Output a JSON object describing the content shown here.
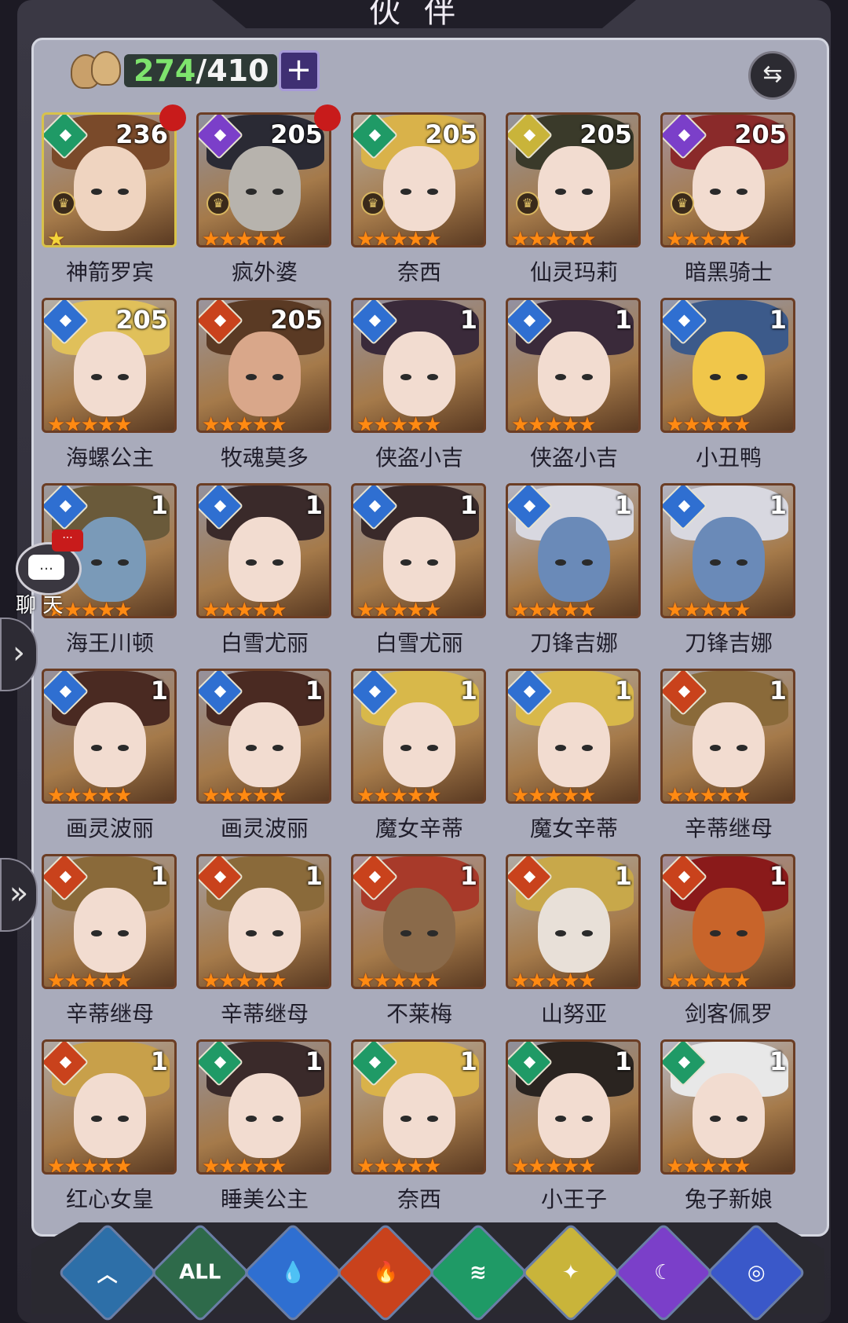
{
  "header": {
    "title": "伙伴"
  },
  "roster": {
    "current": "274",
    "separator": "/",
    "max": "410",
    "add_label": "+",
    "swap_label": "⇆"
  },
  "colors": {
    "water": "#2f6fd1",
    "fire": "#c9421c",
    "wind": "#1f9a66",
    "light": "#c9b43a",
    "dark": "#7b3fc9",
    "leader": "#c81b1b"
  },
  "cards": [
    {
      "name": "神箭罗宾",
      "level": "236",
      "element": "wind",
      "stars": "★",
      "star_color": "yellow",
      "gold": true,
      "crown": true,
      "badge": true,
      "skin": "#efd4c0",
      "hair": "#7a4a2a"
    },
    {
      "name": "疯外婆",
      "level": "205",
      "element": "dark",
      "stars": "★★★★★",
      "crown": true,
      "badge": true,
      "skin": "#b7b3ad",
      "hair": "#2a2a34"
    },
    {
      "name": "奈西",
      "level": "205",
      "element": "wind",
      "stars": "★★★★★",
      "crown": true,
      "skin": "#f2dcd0",
      "hair": "#d9b24a"
    },
    {
      "name": "仙灵玛莉",
      "level": "205",
      "element": "light",
      "stars": "★★★★★",
      "crown": true,
      "skin": "#f2dcd0",
      "hair": "#3a3a2a"
    },
    {
      "name": "暗黑骑士",
      "level": "205",
      "element": "dark",
      "stars": "★★★★★",
      "crown": true,
      "skin": "#f2dcd0",
      "hair": "#8a2a2a"
    },
    {
      "name": "海螺公主",
      "level": "205",
      "element": "water",
      "stars": "★★★★★",
      "skin": "#f2dcd0",
      "hair": "#e0c05a"
    },
    {
      "name": "牧魂莫多",
      "level": "205",
      "element": "fire",
      "stars": "★★★★★",
      "skin": "#d9a78a",
      "hair": "#5a3a24"
    },
    {
      "name": "侠盗小吉",
      "level": "1",
      "element": "water",
      "stars": "★★★★★",
      "skin": "#f2dcd0",
      "hair": "#3a2a3a"
    },
    {
      "name": "侠盗小吉",
      "level": "1",
      "element": "water",
      "stars": "★★★★★",
      "skin": "#f2dcd0",
      "hair": "#3a2a3a"
    },
    {
      "name": "小丑鸭",
      "level": "1",
      "element": "water",
      "stars": "★★★★★",
      "skin": "#f0c64a",
      "hair": "#3c5a8a"
    },
    {
      "name": "海王川顿",
      "level": "1",
      "element": "water",
      "stars": "★★★★★",
      "skin": "#7a9ab8",
      "hair": "#6a5a3a"
    },
    {
      "name": "白雪尤丽",
      "level": "1",
      "element": "water",
      "stars": "★★★★★",
      "skin": "#f2dcd0",
      "hair": "#3a2a2a"
    },
    {
      "name": "白雪尤丽",
      "level": "1",
      "element": "water",
      "stars": "★★★★★",
      "skin": "#f2dcd0",
      "hair": "#3a2a2a"
    },
    {
      "name": "刀锋吉娜",
      "level": "1",
      "element": "water",
      "stars": "★★★★★",
      "skin": "#6a8ab8",
      "hair": "#d8d8e0"
    },
    {
      "name": "刀锋吉娜",
      "level": "1",
      "element": "water",
      "stars": "★★★★★",
      "skin": "#6a8ab8",
      "hair": "#d8d8e0"
    },
    {
      "name": "画灵波丽",
      "level": "1",
      "element": "water",
      "stars": "★★★★★",
      "skin": "#f2dcd0",
      "hair": "#4a2a22"
    },
    {
      "name": "画灵波丽",
      "level": "1",
      "element": "water",
      "stars": "★★★★★",
      "skin": "#f2dcd0",
      "hair": "#4a2a22"
    },
    {
      "name": "魔女辛蒂",
      "level": "1",
      "element": "water",
      "stars": "★★★★★",
      "skin": "#f2dcd0",
      "hair": "#d8b84a"
    },
    {
      "name": "魔女辛蒂",
      "level": "1",
      "element": "water",
      "stars": "★★★★★",
      "skin": "#f2dcd0",
      "hair": "#d8b84a"
    },
    {
      "name": "辛蒂继母",
      "level": "1",
      "element": "fire",
      "stars": "★★★★★",
      "skin": "#f2dcd0",
      "hair": "#8a6a3a"
    },
    {
      "name": "辛蒂继母",
      "level": "1",
      "element": "fire",
      "stars": "★★★★★",
      "skin": "#f2dcd0",
      "hair": "#8a6a3a"
    },
    {
      "name": "辛蒂继母",
      "level": "1",
      "element": "fire",
      "stars": "★★★★★",
      "skin": "#f2dcd0",
      "hair": "#8a6a3a"
    },
    {
      "name": "不莱梅",
      "level": "1",
      "element": "fire",
      "stars": "★★★★★",
      "skin": "#8a6a4a",
      "hair": "#a83a2a"
    },
    {
      "name": "山努亚",
      "level": "1",
      "element": "fire",
      "stars": "★★★★★",
      "skin": "#e8e0d8",
      "hair": "#c8a84a"
    },
    {
      "name": "剑客佩罗",
      "level": "1",
      "element": "fire",
      "stars": "★★★★★",
      "skin": "#c8642a",
      "hair": "#8a1a1a"
    },
    {
      "name": "红心女皇",
      "level": "1",
      "element": "fire",
      "stars": "★★★★★",
      "skin": "#f2dcd0",
      "hair": "#c8a04a"
    },
    {
      "name": "睡美公主",
      "level": "1",
      "element": "wind",
      "stars": "★★★★★",
      "skin": "#f2dcd0",
      "hair": "#3a2a2a"
    },
    {
      "name": "奈西",
      "level": "1",
      "element": "wind",
      "stars": "★★★★★",
      "skin": "#f2dcd0",
      "hair": "#d9b24a"
    },
    {
      "name": "小王子",
      "level": "1",
      "element": "wind",
      "stars": "★★★★★",
      "skin": "#f2dcd0",
      "hair": "#2a2420"
    },
    {
      "name": "兔子新娘",
      "level": "1",
      "element": "wind",
      "stars": "★★★★★",
      "skin": "#f2dcd0",
      "hair": "#e8e8e8"
    }
  ],
  "chat": {
    "label": "聊 天",
    "icon": "…"
  },
  "side_arrows": [
    "›",
    "»"
  ],
  "filters": [
    {
      "label": "︿",
      "icon": "rank-filter-icon",
      "color": "#2d6fa8"
    },
    {
      "label": "ALL",
      "icon": "all-filter-icon",
      "color": "#2e6a4a"
    },
    {
      "label": "💧",
      "icon": "water-filter-icon",
      "color": "#2f6fd1"
    },
    {
      "label": "🔥",
      "icon": "fire-filter-icon",
      "color": "#c9421c"
    },
    {
      "label": "≋",
      "icon": "wind-filter-icon",
      "color": "#1f9a66"
    },
    {
      "label": "✦",
      "icon": "light-filter-icon",
      "color": "#c9b43a"
    },
    {
      "label": "☾",
      "icon": "dark-filter-icon",
      "color": "#7b3fc9"
    },
    {
      "label": "◎",
      "icon": "space-filter-icon",
      "color": "#3a58c9"
    }
  ]
}
